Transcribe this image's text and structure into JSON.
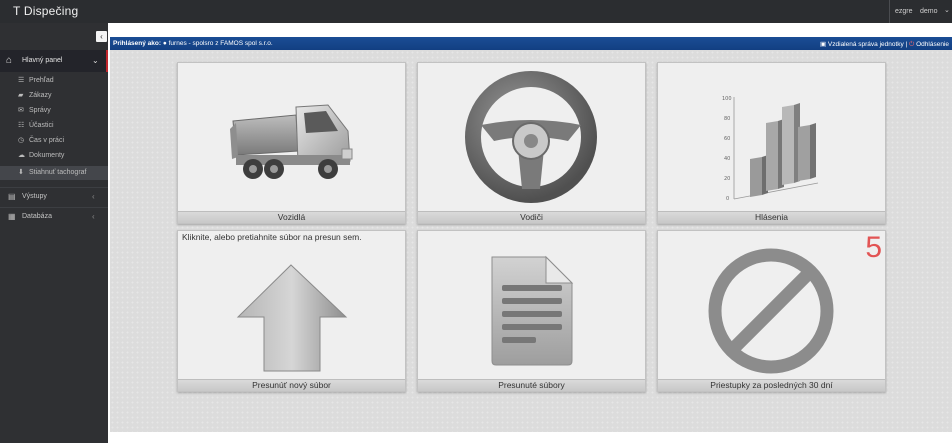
{
  "app": {
    "title": "T Dispečing"
  },
  "user": {
    "label": "ezgre",
    "name": "demo",
    "caret": "⌄"
  },
  "sidebar": {
    "collapse_icon": "‹",
    "main": {
      "label": "Hlavný panel",
      "chevron": "⌄"
    },
    "items": [
      {
        "label": "Prehľad",
        "icon": "list-icon",
        "glyph": "☰"
      },
      {
        "label": "Zákazy",
        "icon": "folder-icon",
        "glyph": "▰"
      },
      {
        "label": "Správy",
        "icon": "envelope-icon",
        "glyph": "✉"
      },
      {
        "label": "Účastici",
        "icon": "users-icon",
        "glyph": "☷"
      },
      {
        "label": "Čas v práci",
        "icon": "clock-icon",
        "glyph": "◷"
      },
      {
        "label": "Dokumenty",
        "icon": "cloud-icon",
        "glyph": "☁"
      },
      {
        "label": "Stiahnuť tachograf",
        "icon": "download-icon",
        "glyph": "⬇"
      }
    ],
    "sections": [
      {
        "label": "Výstupy",
        "icon": "bars-icon",
        "glyph": "▤",
        "chevron": "‹"
      },
      {
        "label": "Databáza",
        "icon": "database-icon",
        "glyph": "▦",
        "chevron": "‹"
      }
    ]
  },
  "infobar": {
    "logged_label": "Prihlásený ako:",
    "logged_value": "furnes - spolsro z FAMOS spol s.r.o.",
    "remote_label": "Vzdialená správa jednotky",
    "logout_label": "Odhlásenie"
  },
  "tiles": {
    "vehicles": "Vozidlá",
    "drivers": "Vodiči",
    "reports": "Hlásenia",
    "upload": "Presunúť nový súbor",
    "upload_hint": "Kliknite, alebo pretiahnite súbor na presun sem.",
    "moved_files": "Presunuté súbory",
    "violations": "Priestupky za posledných 30 dní",
    "violations_count": "5"
  },
  "chart_icon": {
    "ticks": [
      "100",
      "80",
      "60",
      "40",
      "20",
      "0"
    ]
  }
}
